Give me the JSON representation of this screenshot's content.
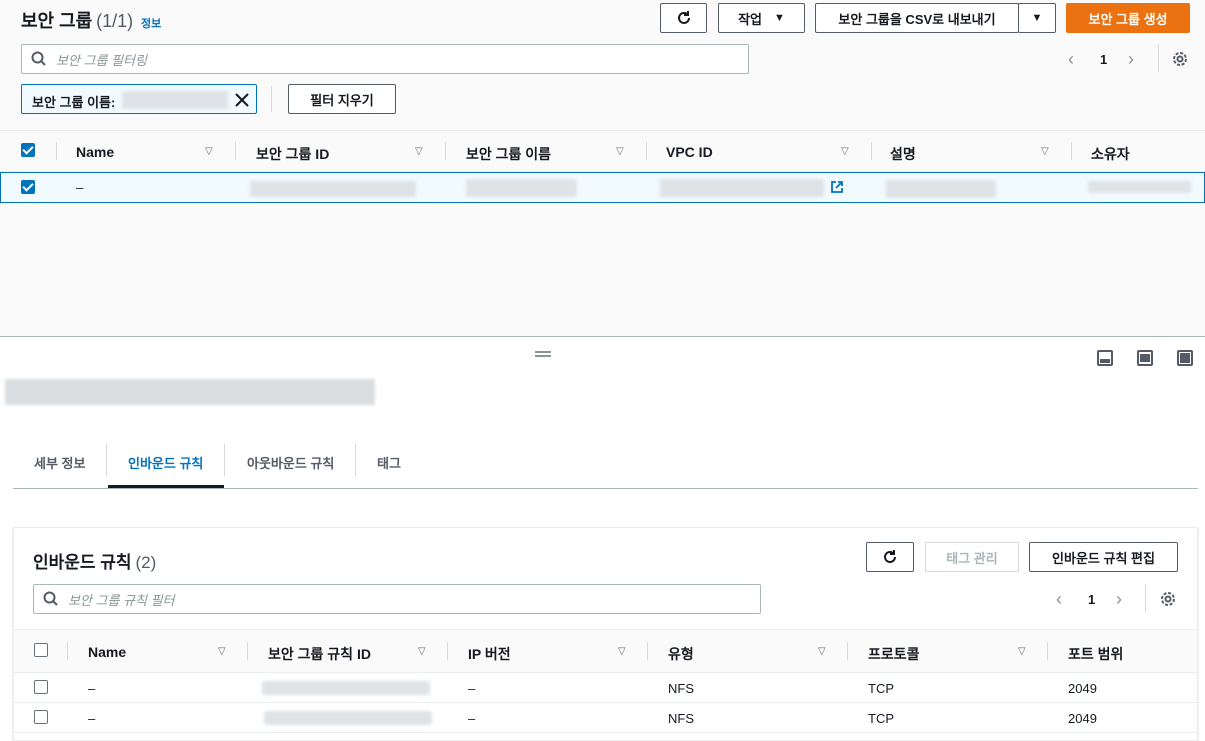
{
  "top": {
    "title": "보안 그룹",
    "count": "(1/1)",
    "info_link": "정보",
    "buttons": {
      "actions": "작업",
      "export": "보안 그룹을 CSV로 내보내기",
      "create": "보안 그룹 생성"
    },
    "search_placeholder": "보안 그룹 필터링",
    "filter_token_label": "보안 그룹 이름:",
    "clear_filters": "필터 지우기",
    "page_number": "1",
    "columns": [
      "Name",
      "보안 그룹 ID",
      "보안 그룹 이름",
      "VPC ID",
      "설명",
      "소유자"
    ],
    "rows": [
      {
        "name": "–"
      }
    ]
  },
  "detail": {
    "tabs": [
      "세부 정보",
      "인바운드 규칙",
      "아웃바운드 규칙",
      "태그"
    ],
    "active_tab": "인바운드 규칙",
    "inbound": {
      "title": "인바운드 규칙",
      "count": "(2)",
      "buttons": {
        "manage_tags": "태그 관리",
        "edit_rules": "인바운드 규칙 편집"
      },
      "search_placeholder": "보안 그룹 규칙 필터",
      "page_number": "1",
      "columns": [
        "Name",
        "보안 그룹 규칙 ID",
        "IP 버전",
        "유형",
        "프로토콜",
        "포트 범위"
      ],
      "rows": [
        {
          "name": "–",
          "ip_version": "–",
          "type": "NFS",
          "protocol": "TCP",
          "port_range": "2049"
        },
        {
          "name": "–",
          "ip_version": "–",
          "type": "NFS",
          "protocol": "TCP",
          "port_range": "2049"
        }
      ]
    }
  },
  "colors": {
    "accent": "#0073bb",
    "primary_button": "#ec7211",
    "selected_row_bg": "#f1faff"
  }
}
